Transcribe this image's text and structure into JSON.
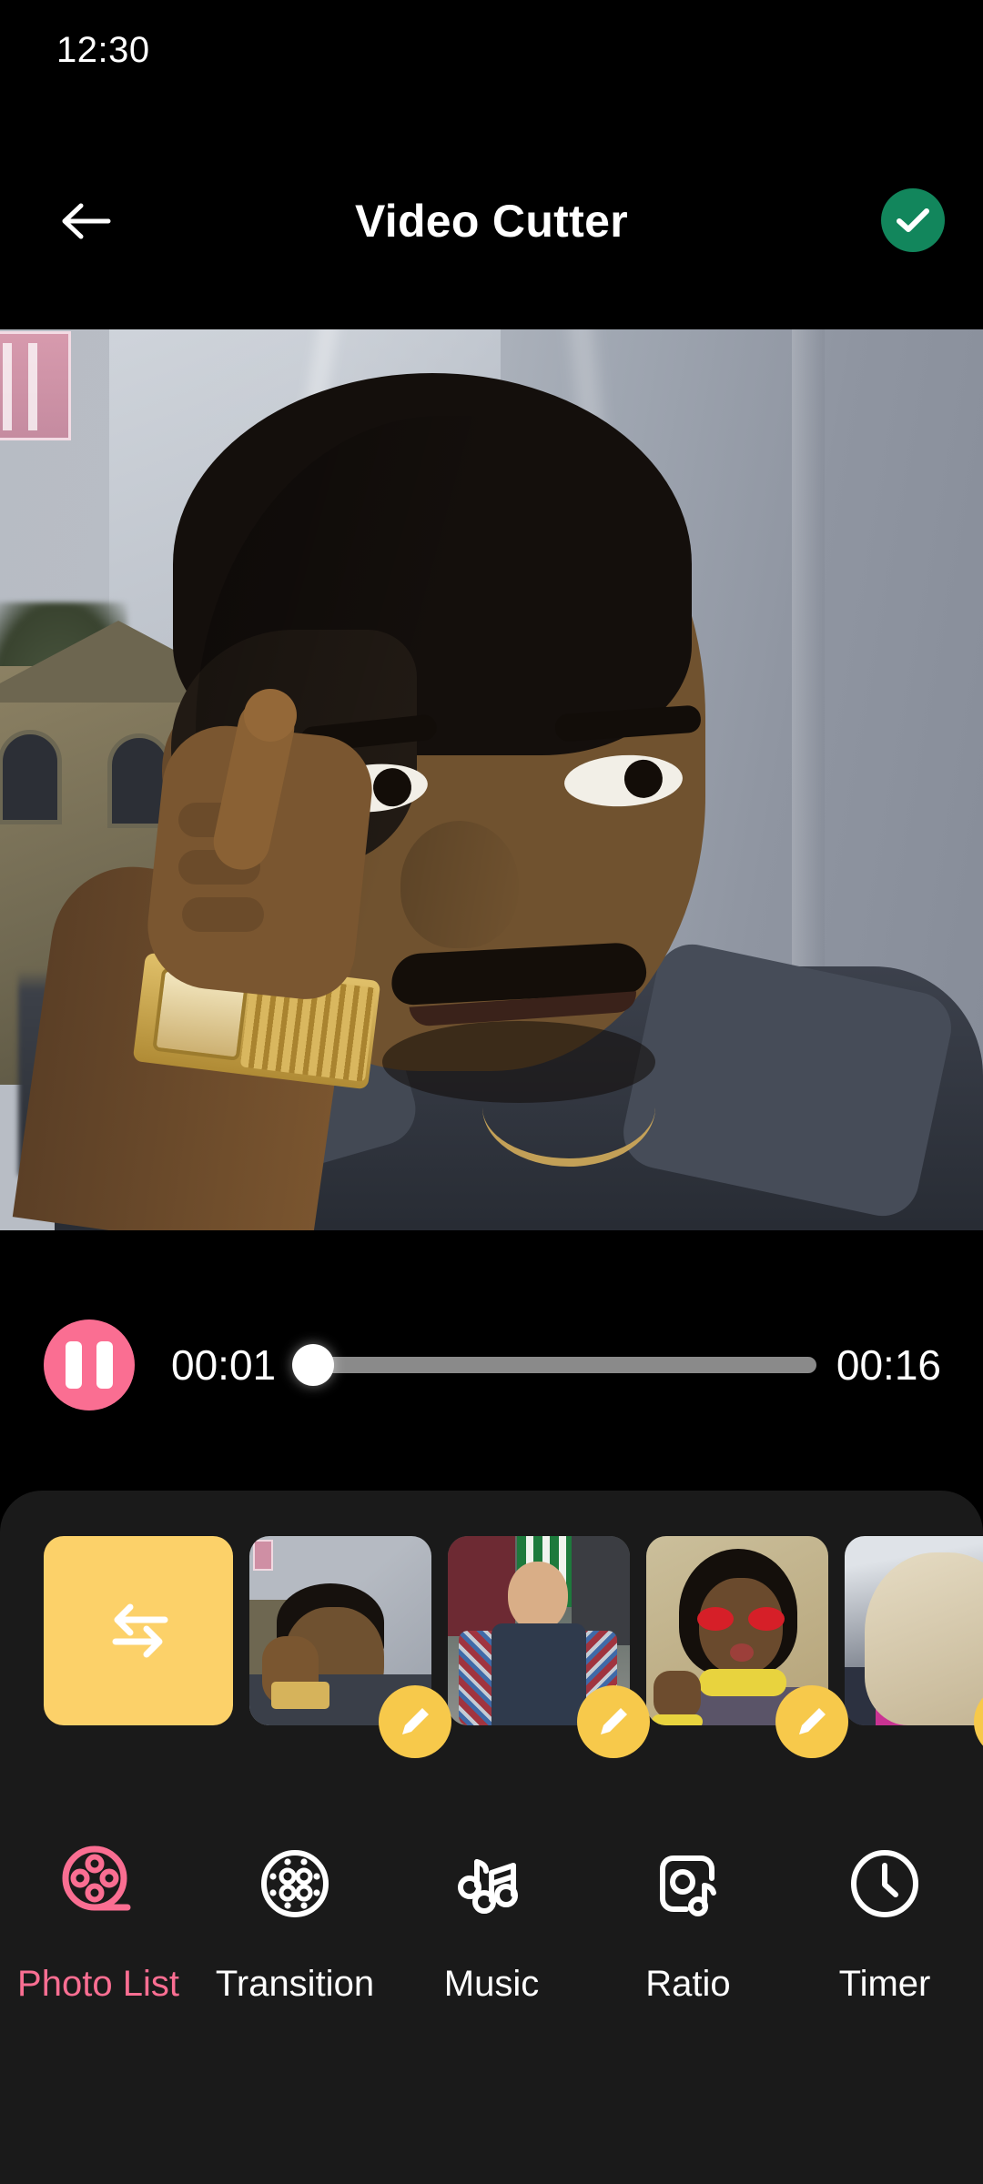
{
  "status_bar": {
    "time": "12:30"
  },
  "app_bar": {
    "title": "Video Cutter",
    "back_icon": "arrow-left-icon",
    "confirm_icon": "check-icon",
    "confirm_color": "#12865C"
  },
  "player": {
    "state": "playing",
    "pause_icon": "pause-icon",
    "accent_color": "#FA6E92",
    "current_time": "00:01",
    "total_time": "00:16",
    "progress_percent": 2
  },
  "photo_strip": {
    "reorder_button": {
      "label": "",
      "icon": "swap-arrows-icon",
      "color": "#FCD169"
    },
    "edit_badge_icon": "pencil-icon",
    "edit_badge_color": "#F7C94B",
    "thumbnails": [
      {
        "alt": "man pointing to temple",
        "has_edit_badge": true
      },
      {
        "alt": "man in plaid shirt and vest",
        "has_edit_badge": true
      },
      {
        "alt": "person with red sunglasses",
        "has_edit_badge": true
      },
      {
        "alt": "person with blonde hair in car",
        "has_edit_badge": true
      }
    ]
  },
  "tabs": [
    {
      "label": "Photo List",
      "icon": "film-reel-icon",
      "active": true
    },
    {
      "label": "Transition",
      "icon": "transition-dots-icon",
      "active": false
    },
    {
      "label": "Music",
      "icon": "music-notes-icon",
      "active": false
    },
    {
      "label": "Ratio",
      "icon": "aspect-ratio-icon",
      "active": false
    },
    {
      "label": "Timer",
      "icon": "clock-icon",
      "active": false
    }
  ],
  "colors": {
    "background": "#000000",
    "panel": "#1A1A1A",
    "accent_pink": "#FA6E92",
    "accent_yellow": "#FCD169",
    "accent_green": "#12865C"
  }
}
